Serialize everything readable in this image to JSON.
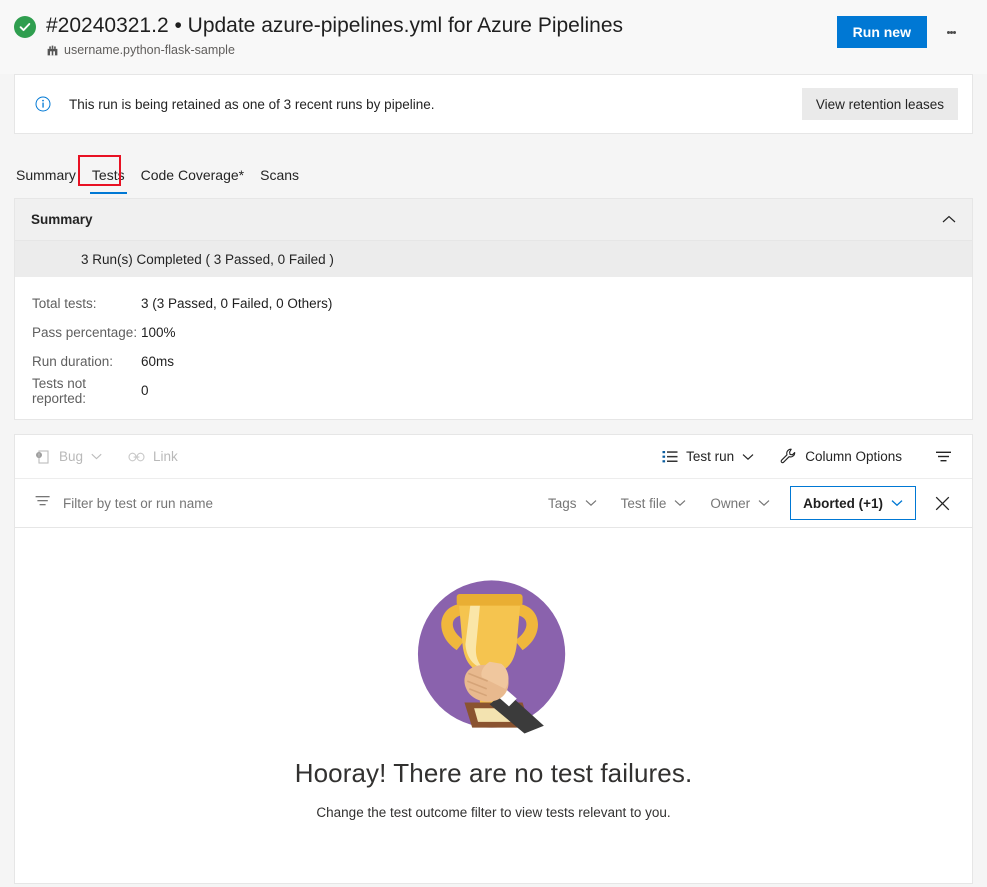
{
  "header": {
    "status_icon": "success-check-icon",
    "title": "#20240321.2 • Update azure-pipelines.yml for Azure Pipelines",
    "repo_icon": "repository-icon",
    "repo": "username.python-flask-sample",
    "run_new_label": "Run new",
    "more_actions_icon": "more-actions-icon"
  },
  "banner": {
    "info_icon": "info-icon",
    "message": "This run is being retained as one of 3 recent runs by pipeline.",
    "action_label": "View retention leases"
  },
  "tabs": [
    {
      "label": "Summary",
      "active": false
    },
    {
      "label": "Tests",
      "active": true,
      "highlighted": true
    },
    {
      "label": "Code Coverage*",
      "active": false
    },
    {
      "label": "Scans",
      "active": false
    }
  ],
  "summary": {
    "header": "Summary",
    "collapse_icon": "chevron-up-icon",
    "runs_line": "3 Run(s) Completed ( 3 Passed, 0 Failed )",
    "stats": [
      {
        "label": "Total tests:",
        "value": "3 (3 Passed, 0 Failed, 0 Others)"
      },
      {
        "label": "Pass percentage:",
        "value": "100%"
      },
      {
        "label": "Run duration:",
        "value": "60ms"
      },
      {
        "label": "Tests not reported:",
        "value": "0"
      }
    ]
  },
  "toolbar": {
    "bug_icon": "bug-icon",
    "bug_label": "Bug",
    "bug_caret_icon": "chevron-down-icon",
    "link_icon": "link-icon",
    "link_label": "Link",
    "testrun_icon": "list-icon",
    "testrun_label": "Test run",
    "testrun_caret_icon": "chevron-down-icon",
    "column_options_icon": "wrench-icon",
    "column_options_label": "Column Options",
    "filter_toggle_icon": "filter-icon"
  },
  "filters": {
    "filter_icon": "filter-icon",
    "search_placeholder": "Filter by test or run name",
    "search_value": "",
    "tags_label": "Tags",
    "testfile_label": "Test file",
    "owner_label": "Owner",
    "outcome_label": "Aborted (+1)",
    "caret_icon": "chevron-down-icon",
    "clear_icon": "close-icon"
  },
  "empty_state": {
    "illustration": "trophy-illustration",
    "title": "Hooray! There are no test failures.",
    "subtitle": "Change the test outcome filter to view tests relevant to you."
  },
  "colors": {
    "accent": "#0078d4",
    "success": "#2f9e4f",
    "highlight": "#e81123",
    "trophy_bg": "#8a62ad"
  }
}
